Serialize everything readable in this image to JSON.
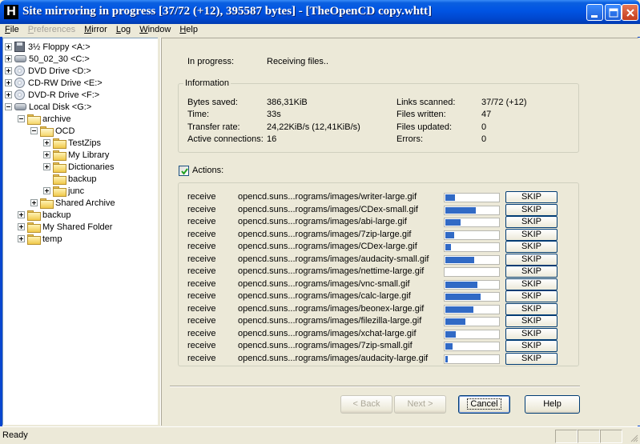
{
  "window": {
    "title": "Site mirroring in progress [37/72 (+12), 395587 bytes] - [TheOpenCD copy.whtt]",
    "app_icon_letter": "H"
  },
  "menubar": [
    {
      "label": "File",
      "enabled": true
    },
    {
      "label": "Preferences",
      "enabled": false
    },
    {
      "label": "Mirror",
      "enabled": true
    },
    {
      "label": "Log",
      "enabled": true
    },
    {
      "label": "Window",
      "enabled": true
    },
    {
      "label": "Help",
      "enabled": true
    }
  ],
  "tree": [
    {
      "label": "3½ Floppy <A:>",
      "icon": "floppy-icon",
      "expander": "plus"
    },
    {
      "label": "50_02_30 <C:>",
      "icon": "drive-icon",
      "expander": "plus"
    },
    {
      "label": "DVD Drive <D:>",
      "icon": "cd-icon",
      "expander": "plus"
    },
    {
      "label": "CD-RW Drive <E:>",
      "icon": "cd-icon",
      "expander": "plus"
    },
    {
      "label": "DVD-R Drive <F:>",
      "icon": "cd-icon",
      "expander": "plus"
    },
    {
      "label": "Local Disk <G:>",
      "icon": "drive-icon",
      "expander": "minus"
    },
    {
      "label": "archive",
      "icon": "folder-open-icon",
      "expander": "minus"
    },
    {
      "label": "OCD",
      "icon": "folder-open-icon",
      "expander": "minus"
    },
    {
      "label": "TestZips",
      "icon": "folder-icon",
      "expander": "plus"
    },
    {
      "label": "My Library",
      "icon": "folder-icon",
      "expander": "plus"
    },
    {
      "label": "Dictionaries",
      "icon": "folder-icon",
      "expander": "plus"
    },
    {
      "label": "backup",
      "icon": "folder-icon",
      "expander": "none"
    },
    {
      "label": "junc",
      "icon": "folder-icon",
      "expander": "plus"
    },
    {
      "label": "Shared Archive",
      "icon": "folder-icon",
      "expander": "plus"
    },
    {
      "label": "backup",
      "icon": "folder-icon",
      "expander": "plus"
    },
    {
      "label": "My Shared Folder",
      "icon": "folder-icon",
      "expander": "plus"
    },
    {
      "label": "temp",
      "icon": "folder-icon",
      "expander": "plus"
    }
  ],
  "progress": {
    "label": "In progress:",
    "value": "Receiving files.."
  },
  "information": {
    "title": "Information",
    "left": [
      {
        "label": "Bytes saved:",
        "value": "386,31KiB"
      },
      {
        "label": "Time:",
        "value": "33s"
      },
      {
        "label": "Transfer rate:",
        "value": "24,22KiB/s (12,41KiB/s)"
      },
      {
        "label": "Active connections:",
        "value": "16"
      }
    ],
    "right": [
      {
        "label": "Links scanned:",
        "value": "37/72 (+12)"
      },
      {
        "label": "Files written:",
        "value": "47"
      },
      {
        "label": "Files updated:",
        "value": "0"
      },
      {
        "label": "Errors:",
        "value": "0"
      }
    ]
  },
  "actions": {
    "checkbox_label": "Actions:",
    "checked": true,
    "skip_label": "SKIP",
    "rows": [
      {
        "action": "receive",
        "file": "opencd.suns...rograms/images/writer-large.gif",
        "progress": 0.18
      },
      {
        "action": "receive",
        "file": "opencd.suns...rograms/images/CDex-small.gif",
        "progress": 0.57
      },
      {
        "action": "receive",
        "file": "opencd.suns...rograms/images/abi-large.gif",
        "progress": 0.29
      },
      {
        "action": "receive",
        "file": "opencd.suns...rograms/images/7zip-large.gif",
        "progress": 0.16
      },
      {
        "action": "receive",
        "file": "opencd.suns...rograms/images/CDex-large.gif",
        "progress": 0.1
      },
      {
        "action": "receive",
        "file": "opencd.suns...rograms/images/audacity-small.gif",
        "progress": 0.54
      },
      {
        "action": "receive",
        "file": "opencd.suns...rograms/images/nettime-large.gif",
        "progress": 0.0
      },
      {
        "action": "receive",
        "file": "opencd.suns...rograms/images/vnc-small.gif",
        "progress": 0.6
      },
      {
        "action": "receive",
        "file": "opencd.suns...rograms/images/calc-large.gif",
        "progress": 0.66
      },
      {
        "action": "receive",
        "file": "opencd.suns...rograms/images/beonex-large.gif",
        "progress": 0.53
      },
      {
        "action": "receive",
        "file": "opencd.suns...rograms/images/filezilla-large.gif",
        "progress": 0.38
      },
      {
        "action": "receive",
        "file": "opencd.suns...rograms/images/xchat-large.gif",
        "progress": 0.2
      },
      {
        "action": "receive",
        "file": "opencd.suns...rograms/images/7zip-small.gif",
        "progress": 0.13
      },
      {
        "action": "receive",
        "file": "opencd.suns...rograms/images/audacity-large.gif",
        "progress": 0.05
      }
    ]
  },
  "buttons": {
    "back": "< Back",
    "next": "Next >",
    "cancel": "Cancel",
    "help": "Help"
  },
  "statusbar": {
    "text": "Ready"
  },
  "colors": {
    "titlebar": "#0054e3",
    "progress_fill": "#316ac5",
    "window_bg": "#ece9d8"
  }
}
